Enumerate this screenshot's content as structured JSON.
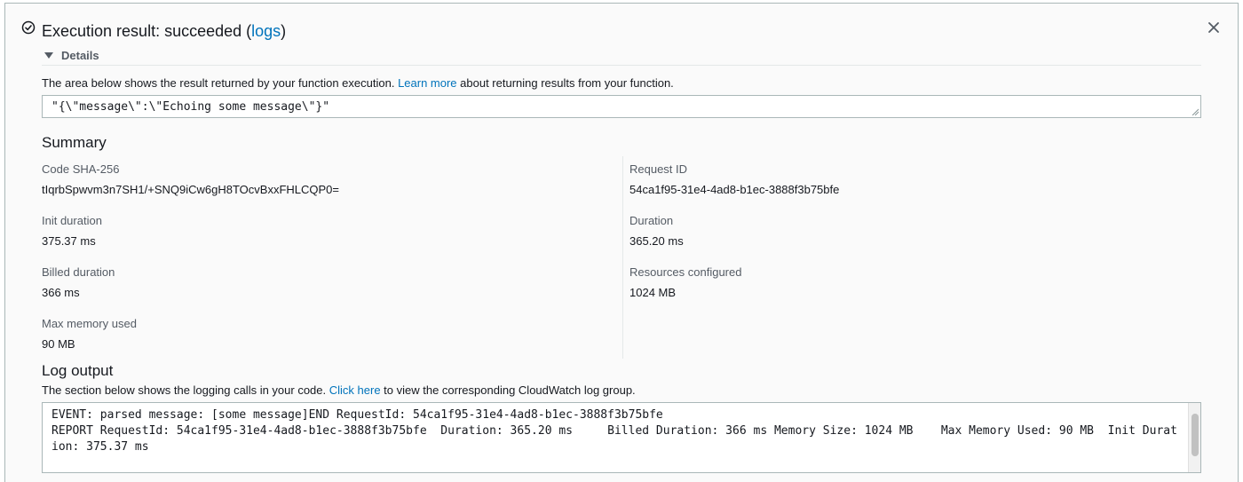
{
  "header": {
    "title_prefix": "Execution result: succeeded (",
    "logs_link": "logs",
    "title_suffix": ")"
  },
  "details": {
    "toggle_label": "Details",
    "description_prefix": "The area below shows the result returned by your function execution. ",
    "learn_more_link": "Learn more",
    "description_suffix": " about returning results from your function.",
    "result_value": "\"{\\\"message\\\":\\\"Echoing some message\\\"}\""
  },
  "summary": {
    "title": "Summary",
    "left": [
      {
        "label": "Code SHA-256",
        "value": "tIqrbSpwvm3n7SH1/+SNQ9iCw6gH8TOcvBxxFHLCQP0="
      },
      {
        "label": "Init duration",
        "value": "375.37 ms"
      },
      {
        "label": "Billed duration",
        "value": "366 ms"
      },
      {
        "label": "Max memory used",
        "value": "90 MB"
      }
    ],
    "right": [
      {
        "label": "Request ID",
        "value": "54ca1f95-31e4-4ad8-b1ec-3888f3b75bfe"
      },
      {
        "label": "Duration",
        "value": "365.20 ms"
      },
      {
        "label": "Resources configured",
        "value": "1024 MB"
      }
    ]
  },
  "log": {
    "title": "Log output",
    "description_prefix": "The section below shows the logging calls in your code. ",
    "click_here_link": "Click here",
    "description_suffix": " to view the corresponding CloudWatch log group.",
    "text": "EVENT: parsed message: [some message]END RequestId: 54ca1f95-31e4-4ad8-b1ec-3888f3b75bfe\nREPORT RequestId: 54ca1f95-31e4-4ad8-b1ec-3888f3b75bfe  Duration: 365.20 ms     Billed Duration: 366 ms Memory Size: 1024 MB    Max Memory Used: 90 MB  Init Duration: 375.37 ms"
  },
  "icons": {
    "success": "check-circle-icon",
    "close": "close-icon",
    "details_toggle": "caret-down-icon"
  },
  "colors": {
    "link": "#0073bb",
    "text": "#16191f",
    "muted": "#545b64",
    "border": "#aab7b8",
    "panel_bg": "#fafafa"
  }
}
